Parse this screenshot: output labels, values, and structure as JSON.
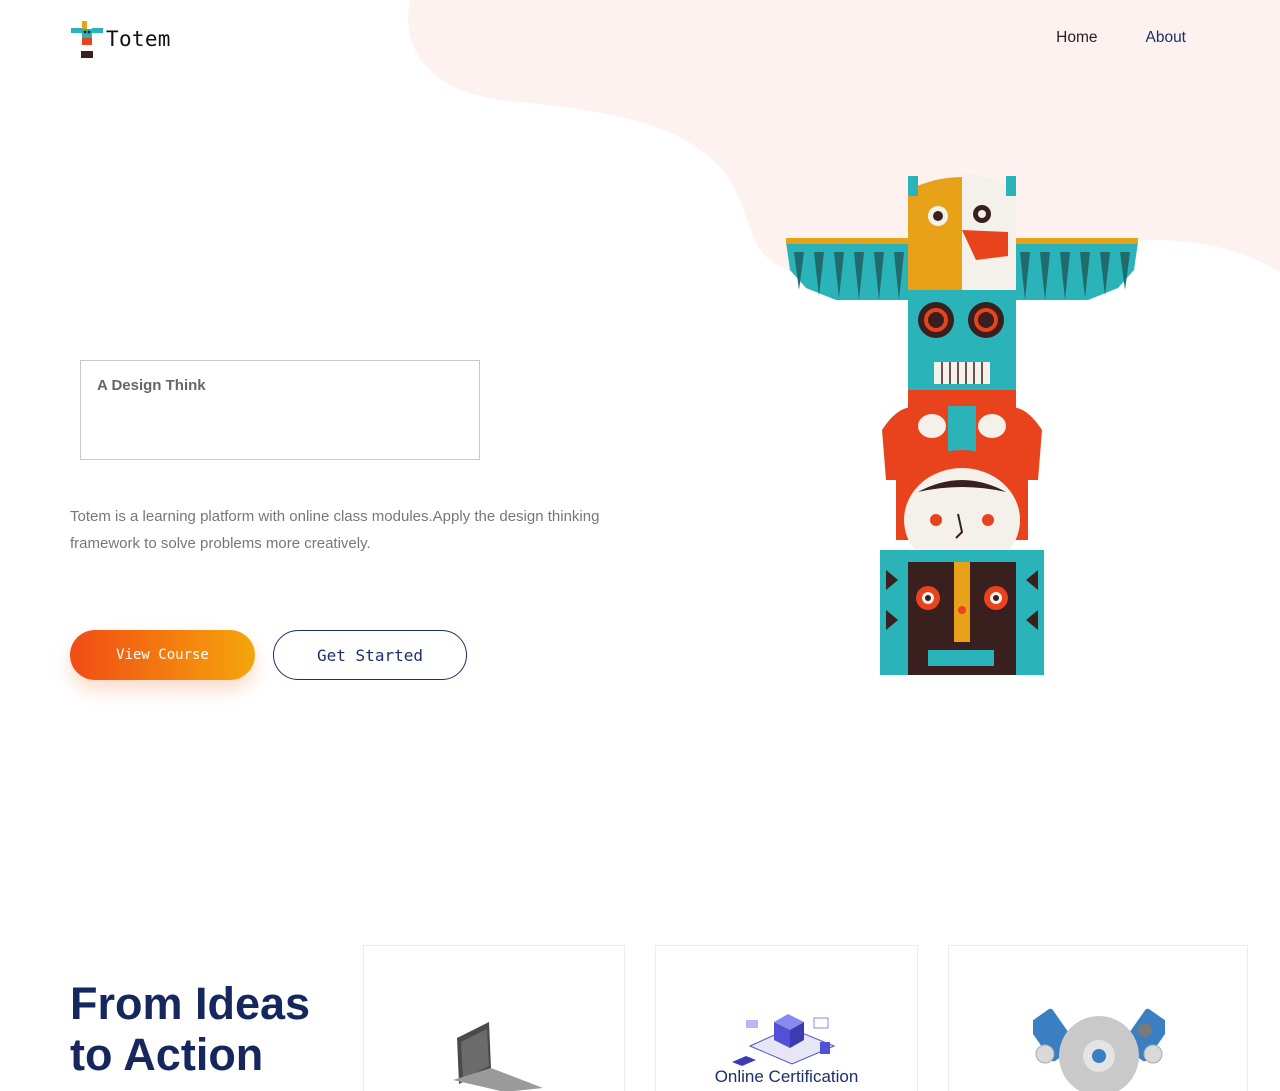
{
  "header": {
    "brand_name": "Totem",
    "nav": {
      "home": "Home",
      "about": "About"
    }
  },
  "hero": {
    "box_title": "A Design Think",
    "description": "Totem is a learning platform with online class modules.Apply the design thinking framework to solve problems more creatively.",
    "view_course": "View Course",
    "get_started": "Get Started"
  },
  "section": {
    "title_line1": "From Ideas",
    "title_line2": "to Action",
    "cards": [
      {
        "label": ""
      },
      {
        "label": "Online Certification"
      },
      {
        "label": ""
      }
    ]
  },
  "colors": {
    "accent_orange": "#f14c14",
    "accent_yellow": "#f5a60b",
    "navy": "#1b2f6b",
    "blob_pink": "#fdf2f0"
  },
  "icons": {
    "logo": "totem-logo-icon",
    "hero": "totem-pole-illustration",
    "card_1": "laptop-illustration",
    "card_2": "isometric-network-illustration",
    "card_3": "engine-gear-illustration"
  }
}
